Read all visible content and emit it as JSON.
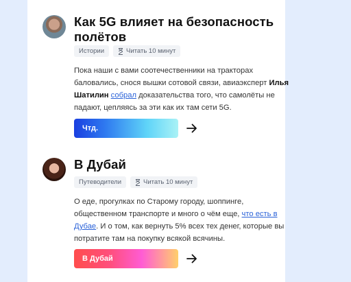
{
  "articles": [
    {
      "title": "Как 5G влияет на безопасность полётов",
      "category": "Истории",
      "read_time": "Читать 10 минут",
      "text_before": "Пока наши с вами соотечественники на тракторах баловались, снося вышки сотовой связи, авиаэксперт ",
      "bold": "Илья Шатилин",
      "link": "собрал",
      "text_after": " доказательства того, что самолёты не падают, цепляясь за эти как их там сети 5G.",
      "button": "Чтд.",
      "avatar_icon": "author-avatar"
    },
    {
      "title": "В Дубай",
      "category": "Путеводители",
      "read_time": "Читать 10 минут",
      "text_before": "О еде, прогулках по Старому городу, шоппинге, общественном транспорте и много о чём еще, ",
      "link": "что есть в Дубае",
      "text_after": ". И о том, как вернуть 5% всех тех денег, которые вы потратите там на покупку всякой всячины.",
      "button": "В Дубай",
      "avatar_icon": "author-avatar"
    }
  ],
  "colors": {
    "page_bg": "#e3edfd",
    "link": "#2a62d8",
    "tag_bg": "#f1f3f6"
  }
}
